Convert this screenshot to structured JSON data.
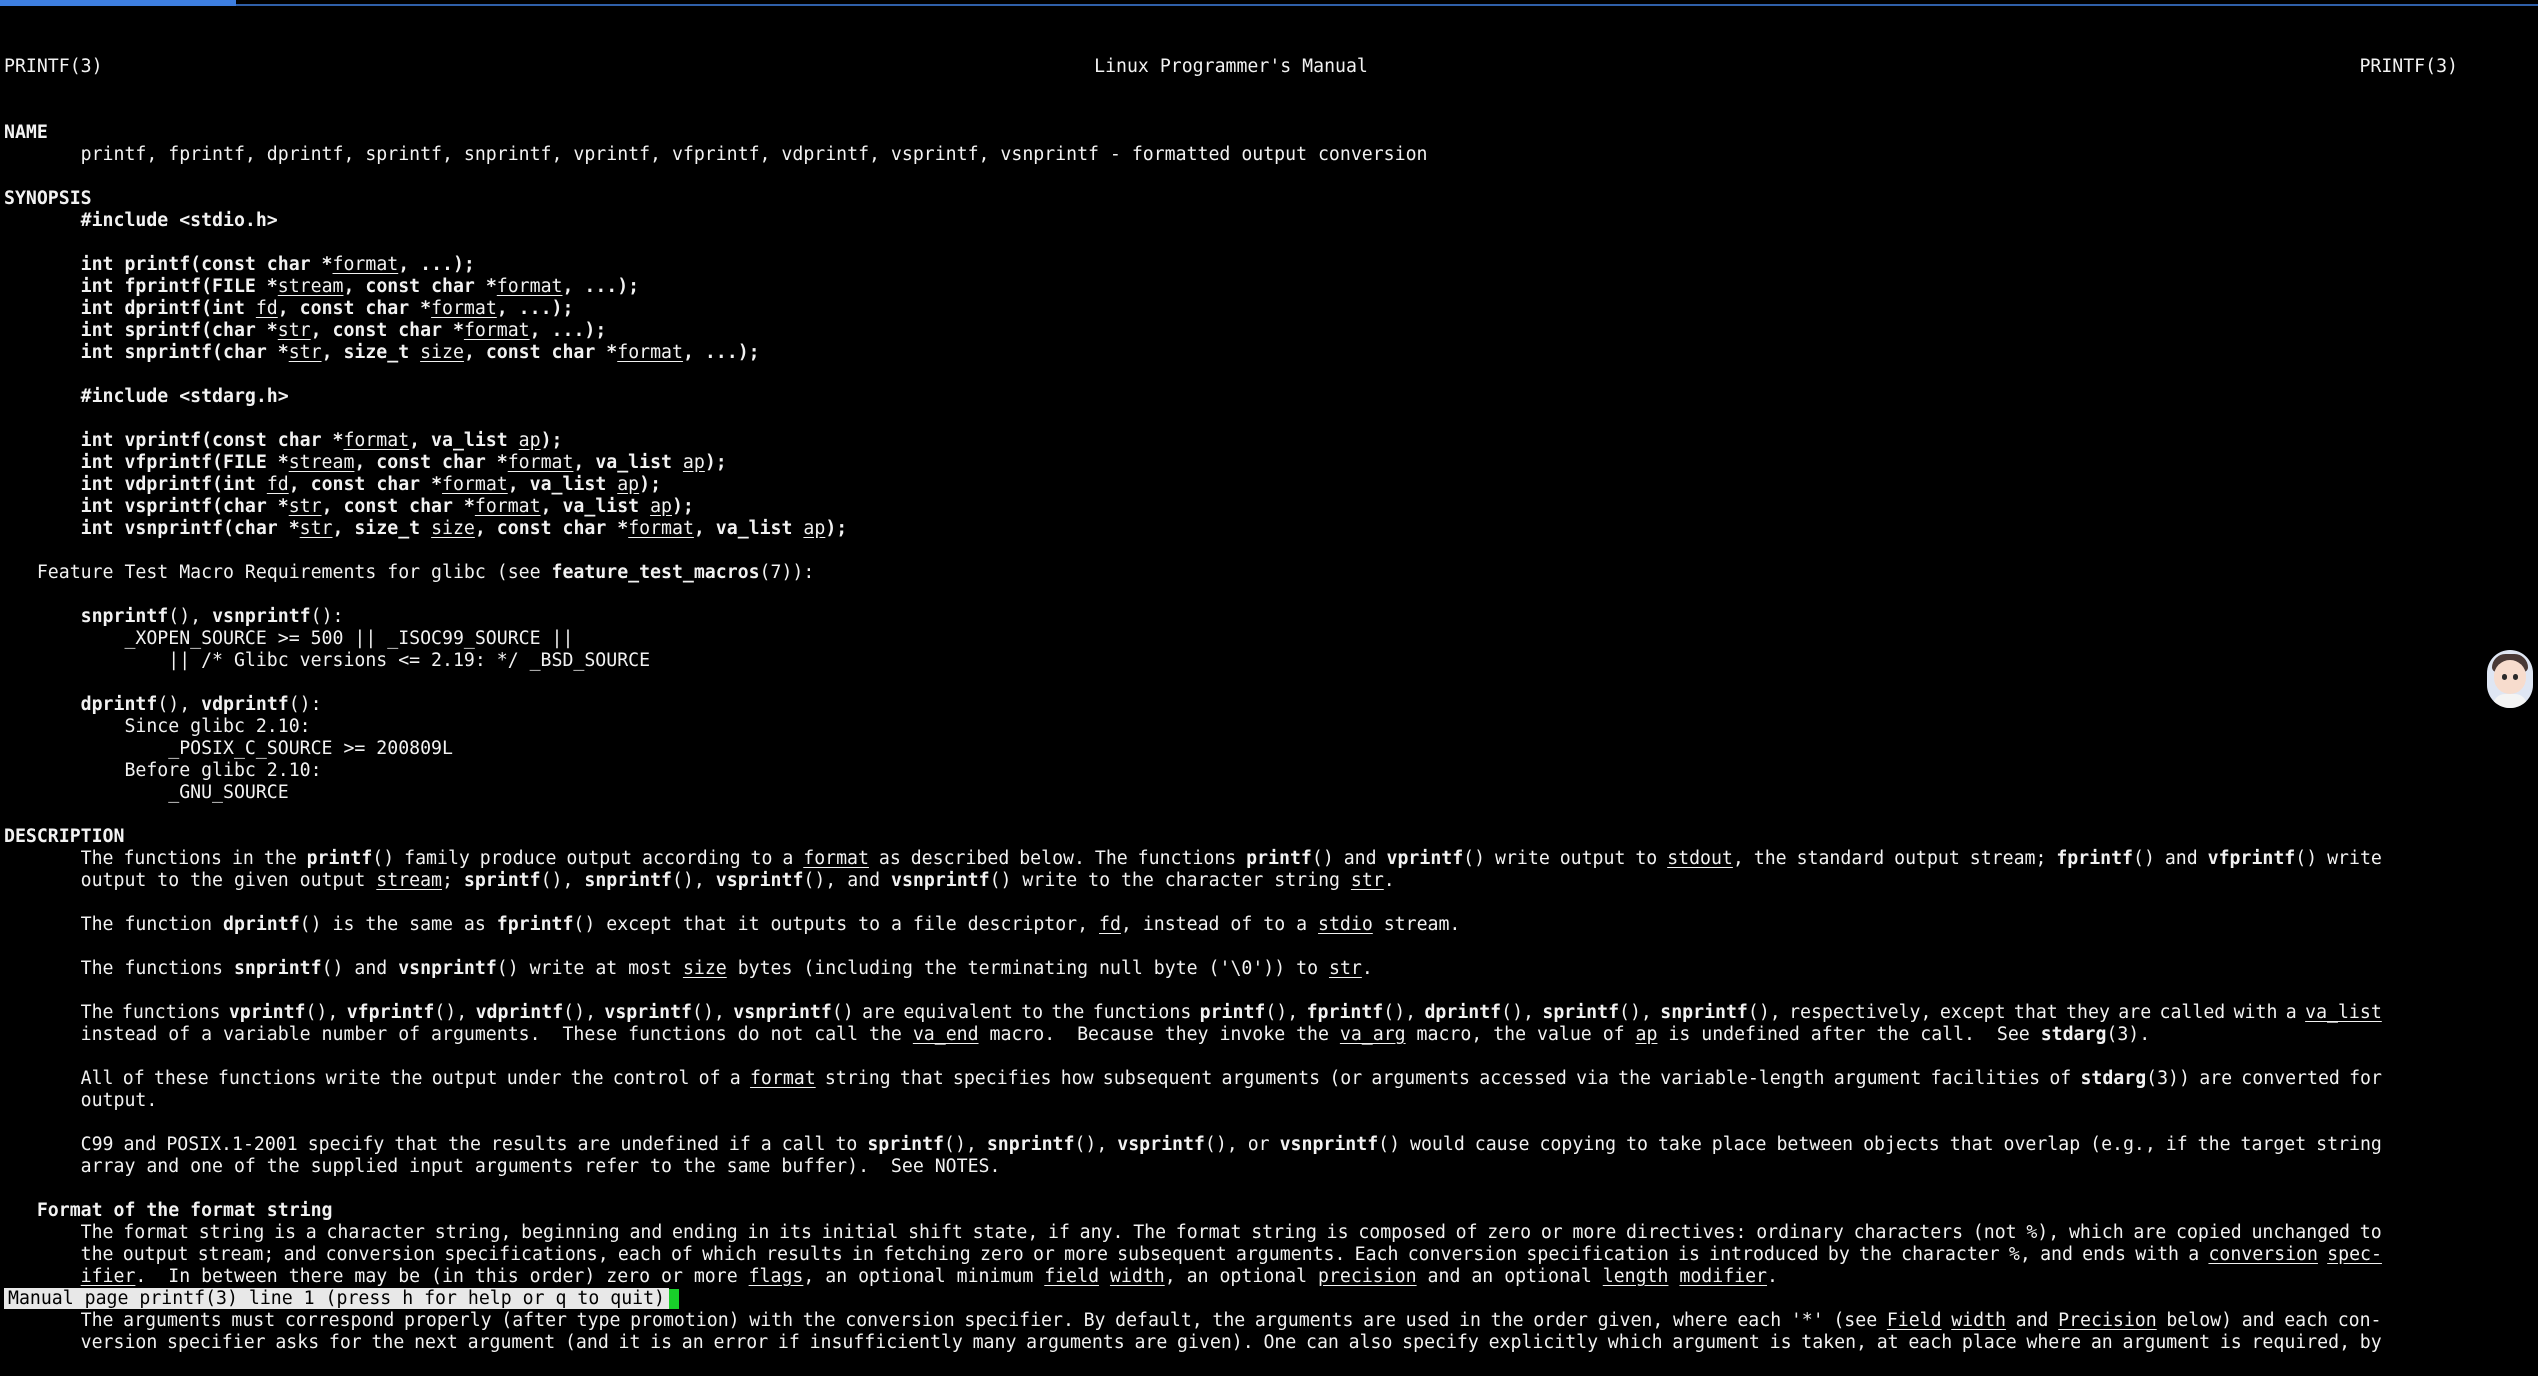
{
  "header": {
    "left": "PRINTF(3)",
    "center": "Linux Programmer's Manual",
    "right": "PRINTF(3)"
  },
  "lines": [
    [
      "NAME:b"
    ],
    [
      "       printf, fprintf, dprintf, sprintf, snprintf, vprintf, vfprintf, vdprintf, vsprintf, vsnprintf - formatted output conversion"
    ],
    [
      ""
    ],
    [
      "SYNOPSIS:b"
    ],
    [
      "       ",
      "#include <stdio.h>:b"
    ],
    [
      ""
    ],
    [
      "       ",
      "int printf(const char *:b",
      "format:u",
      ", ...);:b"
    ],
    [
      "       ",
      "int fprintf(FILE *:b",
      "stream:u",
      ", const char *:b",
      "format:u",
      ", ...);:b"
    ],
    [
      "       ",
      "int dprintf(int :b",
      "fd:u",
      ", const char *:b",
      "format:u",
      ", ...);:b"
    ],
    [
      "       ",
      "int sprintf(char *:b",
      "str:u",
      ", const char *:b",
      "format:u",
      ", ...);:b"
    ],
    [
      "       ",
      "int snprintf(char *:b",
      "str:u",
      ", size_t :b",
      "size:u",
      ", const char *:b",
      "format:u",
      ", ...);:b"
    ],
    [
      ""
    ],
    [
      "       ",
      "#include <stdarg.h>:b"
    ],
    [
      ""
    ],
    [
      "       ",
      "int vprintf(const char *:b",
      "format:u",
      ", va_list :b",
      "ap:u",
      ");:b"
    ],
    [
      "       ",
      "int vfprintf(FILE *:b",
      "stream:u",
      ", const char *:b",
      "format:u",
      ", va_list :b",
      "ap:u",
      ");:b"
    ],
    [
      "       ",
      "int vdprintf(int :b",
      "fd:u",
      ", const char *:b",
      "format:u",
      ", va_list :b",
      "ap:u",
      ");:b"
    ],
    [
      "       ",
      "int vsprintf(char *:b",
      "str:u",
      ", const char *:b",
      "format:u",
      ", va_list :b",
      "ap:u",
      ");:b"
    ],
    [
      "       ",
      "int vsnprintf(char *:b",
      "str:u",
      ", size_t :b",
      "size:u",
      ", const char *:b",
      "format:u",
      ", va_list :b",
      "ap:u",
      ");:b"
    ],
    [
      ""
    ],
    [
      "   Feature Test Macro Requirements for glibc (see ",
      "feature_test_macros:b",
      "(7)):"
    ],
    [
      ""
    ],
    [
      "       ",
      "snprintf:b",
      "(), ",
      "vsnprintf:b",
      "():"
    ],
    [
      "           _XOPEN_SOURCE >= 500 || _ISOC99_SOURCE ||"
    ],
    [
      "               || /* Glibc versions <= 2.19: */ _BSD_SOURCE"
    ],
    [
      ""
    ],
    [
      "       ",
      "dprintf:b",
      "(), ",
      "vdprintf:b",
      "():"
    ],
    [
      "           Since glibc 2.10:"
    ],
    [
      "               _POSIX_C_SOURCE >= 200809L"
    ],
    [
      "           Before glibc 2.10:"
    ],
    [
      "               _GNU_SOURCE"
    ],
    [
      ""
    ],
    [
      "DESCRIPTION:b"
    ],
    [
      "#J",
      "       The  functions  in the ",
      "printf:b",
      "() family produce output according to a ",
      "format:u",
      " as described below.  The functions ",
      "printf:b",
      "() and ",
      "vprintf:b",
      "() write output to ",
      "stdout:u",
      ", the standard output stream; ",
      "fprintf:b",
      "() and ",
      "vfprintf:b",
      "() write"
    ],
    [
      "       output to the given output ",
      "stream:u",
      "; ",
      "sprintf:b",
      "(), ",
      "snprintf:b",
      "(), ",
      "vsprintf:b",
      "(), and ",
      "vsnprintf:b",
      "() write to the character string ",
      "str:u",
      "."
    ],
    [
      ""
    ],
    [
      "       The function ",
      "dprintf:b",
      "() is the same as ",
      "fprintf:b",
      "() except that it outputs to a file descriptor, ",
      "fd:u",
      ", instead of to a ",
      "stdio:u",
      " stream."
    ],
    [
      ""
    ],
    [
      "       The functions ",
      "snprintf:b",
      "() and ",
      "vsnprintf:b",
      "() write at most ",
      "size:u",
      " bytes (including the terminating null byte ('\\0')) to ",
      "str:u",
      "."
    ],
    [
      ""
    ],
    [
      "#J",
      "       The functions ",
      "vprintf:b",
      "(), ",
      "vfprintf:b",
      "(), ",
      "vdprintf:b",
      "(), ",
      "vsprintf:b",
      "(), ",
      "vsnprintf:b",
      "() are equivalent to the functions ",
      "printf:b",
      "(), ",
      "fprintf:b",
      "(), ",
      "dprintf:b",
      "(), ",
      "sprintf:b",
      "(), ",
      "snprintf:b",
      "(), respectively, except that they are called with a ",
      "va_list:u"
    ],
    [
      "       instead of a variable number of arguments.  These functions do not call the ",
      "va_end:u",
      " macro.  Because they invoke the ",
      "va_arg:u",
      " macro, the value of ",
      "ap:u",
      " is undefined after the call.  See ",
      "stdarg:b",
      "(3)."
    ],
    [
      ""
    ],
    [
      "#J",
      "       All  of these functions write the output under the control of a ",
      "format:u",
      " string that specifies how subsequent arguments (or arguments accessed via the variable-length argument facilities of ",
      "stdarg:b",
      "(3)) are converted for"
    ],
    [
      "       output."
    ],
    [
      ""
    ],
    [
      "#J",
      "       C99 and POSIX.1-2001 specify that the results are undefined if a call to ",
      "sprintf:b",
      "(), ",
      "snprintf:b",
      "(), ",
      "vsprintf:b",
      "(), or ",
      "vsnprintf:b",
      "() would cause copying to take place between objects that overlap (e.g., if  the  target  string"
    ],
    [
      "       array and one of the supplied input arguments refer to the same buffer).  See NOTES."
    ],
    [
      ""
    ],
    [
      "   Format of the format string:b"
    ],
    [
      "#J",
      "       The  format string is a character string, beginning and ending in its initial shift state, if any.  The format string is composed of zero or more directives: ordinary characters (not %), which are copied unchanged to"
    ],
    [
      "#J",
      "       the output stream; and conversion specifications, each of which results in fetching zero or more subsequent arguments.  Each conversion specification is introduced by the character %, and ends with a ",
      "conversion:u",
      " ",
      "spec-:u"
    ],
    [
      "       ",
      "ifier:u",
      ".  In between there may be (in this order) zero or more ",
      "flags:u",
      ", an optional minimum ",
      "field:u",
      " ",
      "width:u",
      ", an optional ",
      "precision:u",
      " and an optional ",
      "length:u",
      " ",
      "modifier:u",
      "."
    ],
    [
      ""
    ],
    [
      "#J",
      "       The  arguments must correspond properly (after type promotion) with the conversion specifier.  By default, the arguments are used in the order given, where each '*' (see ",
      "Field:u",
      " ",
      "width:u",
      " and ",
      "Precision:u",
      " below) and each con-"
    ],
    [
      "#J",
      "       version specifier asks for the next argument (and it is an error if insufficiently many arguments are given).  One can also specify explicitly which argument is taken, at each place where an argument is required,  by"
    ]
  ],
  "status": {
    "text": "Manual page printf(3) line 1 (press h for help or q to quit)"
  },
  "progress": {
    "fraction": 0.093
  }
}
